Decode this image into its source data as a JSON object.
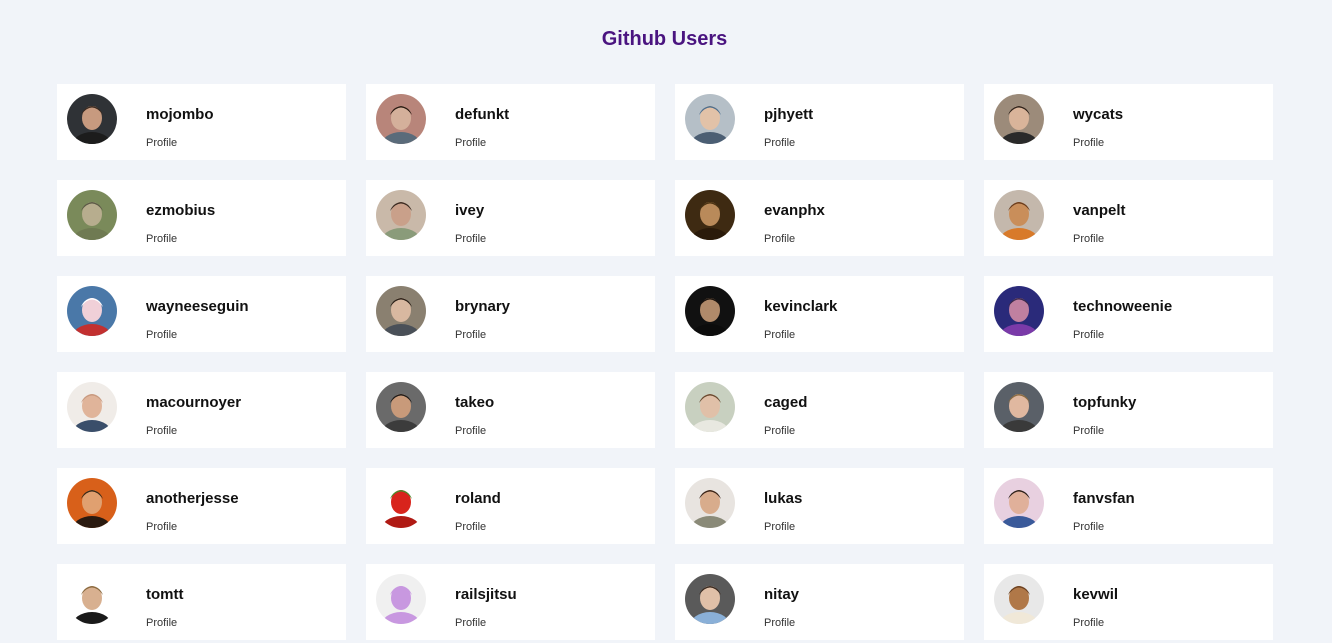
{
  "header": {
    "title": "Github Users"
  },
  "users": [
    {
      "login": "mojombo",
      "profile_label": "Profile",
      "avatar": {
        "bg": "#2f3236",
        "skin": "#c79a7f",
        "hair": "#3a2a20",
        "shirt": "#1c1c1c"
      }
    },
    {
      "login": "defunkt",
      "profile_label": "Profile",
      "avatar": {
        "bg": "#b8857a",
        "skin": "#d4b09b",
        "hair": "#2a1a12",
        "shirt": "#5a6b7a"
      }
    },
    {
      "login": "pjhyett",
      "profile_label": "Profile",
      "avatar": {
        "bg": "#b5bfc7",
        "skin": "#e2c2a8",
        "hair": "#4e6f8e",
        "shirt": "#4b5e73"
      }
    },
    {
      "login": "wycats",
      "profile_label": "Profile",
      "avatar": {
        "bg": "#9c8b7a",
        "skin": "#d9b49a",
        "hair": "#2e221a",
        "shirt": "#2a2a2a"
      }
    },
    {
      "login": "ezmobius",
      "profile_label": "Profile",
      "avatar": {
        "bg": "#7a8a5a",
        "skin": "#b7ad8e",
        "hair": "#5c5a46",
        "shirt": "#6f7a52"
      }
    },
    {
      "login": "ivey",
      "profile_label": "Profile",
      "avatar": {
        "bg": "#c9b9a9",
        "skin": "#c9a08a",
        "hair": "#3b2b22",
        "shirt": "#8a9b7a"
      }
    },
    {
      "login": "evanphx",
      "profile_label": "Profile",
      "avatar": {
        "bg": "#3e2a12",
        "skin": "#b98a5a",
        "hair": "#4a3212",
        "shirt": "#2a1a0a"
      }
    },
    {
      "login": "vanpelt",
      "profile_label": "Profile",
      "avatar": {
        "bg": "#c4b8ac",
        "skin": "#c98e5a",
        "hair": "#6a3c1c",
        "shirt": "#d87a2a"
      }
    },
    {
      "login": "wayneeseguin",
      "profile_label": "Profile",
      "avatar": {
        "bg": "#4a78a8",
        "skin": "#f0d0d8",
        "hair": "#ffffff",
        "shirt": "#c23030"
      }
    },
    {
      "login": "brynary",
      "profile_label": "Profile",
      "avatar": {
        "bg": "#8a8070",
        "skin": "#d8b8a0",
        "hair": "#2a2018",
        "shirt": "#4a5058"
      }
    },
    {
      "login": "kevinclark",
      "profile_label": "Profile",
      "avatar": {
        "bg": "#111111",
        "skin": "#b08a6a",
        "hair": "#1c140e",
        "shirt": "#0c0c0c"
      }
    },
    {
      "login": "technoweenie",
      "profile_label": "Profile",
      "avatar": {
        "bg": "#2a2a7a",
        "skin": "#c080a0",
        "hair": "#3c2a4a",
        "shirt": "#7a3aa8"
      }
    },
    {
      "login": "macournoyer",
      "profile_label": "Profile",
      "avatar": {
        "bg": "#f0ece8",
        "skin": "#e0b49a",
        "hair": "#c89a80",
        "shirt": "#3a4e6a"
      }
    },
    {
      "login": "takeo",
      "profile_label": "Profile",
      "avatar": {
        "bg": "#6a6a6a",
        "skin": "#c89a7a",
        "hair": "#1e1a18",
        "shirt": "#3c3c3c"
      }
    },
    {
      "login": "caged",
      "profile_label": "Profile",
      "avatar": {
        "bg": "#c8d0c0",
        "skin": "#e0c0a8",
        "hair": "#6a4a30",
        "shirt": "#e8e8e0"
      }
    },
    {
      "login": "topfunky",
      "profile_label": "Profile",
      "avatar": {
        "bg": "#5a6068",
        "skin": "#e0b8a0",
        "hair": "#8a6a40",
        "shirt": "#3a3a3a"
      }
    },
    {
      "login": "anotherjesse",
      "profile_label": "Profile",
      "avatar": {
        "bg": "#d8601a",
        "skin": "#e0a070",
        "hair": "#3a2a18",
        "shirt": "#2a1a10"
      }
    },
    {
      "login": "roland",
      "profile_label": "Profile",
      "avatar": {
        "bg": "#ffffff",
        "skin": "#d8241c",
        "hair": "#4a8a2a",
        "shirt": "#b01a14"
      }
    },
    {
      "login": "lukas",
      "profile_label": "Profile",
      "avatar": {
        "bg": "#e8e4e0",
        "skin": "#d8ac8c",
        "hair": "#3a2418",
        "shirt": "#8a8a78"
      }
    },
    {
      "login": "fanvsfan",
      "profile_label": "Profile",
      "avatar": {
        "bg": "#e8d0e0",
        "skin": "#e0b09a",
        "hair": "#2a1e18",
        "shirt": "#3a5a9a"
      }
    },
    {
      "login": "tomtt",
      "profile_label": "Profile",
      "avatar": {
        "bg": "#ffffff",
        "skin": "#d8b090",
        "hair": "#8a6a40",
        "shirt": "#1a1a1a"
      }
    },
    {
      "login": "railsjitsu",
      "profile_label": "Profile",
      "avatar": {
        "bg": "#f0f0f0",
        "skin": "#c898e0",
        "hair": "#c898e0",
        "shirt": "#c898e0"
      }
    },
    {
      "login": "nitay",
      "profile_label": "Profile",
      "avatar": {
        "bg": "#5a5a5a",
        "skin": "#e0c0a8",
        "hair": "#3a2a20",
        "shirt": "#8ab0d8"
      }
    },
    {
      "login": "kevwil",
      "profile_label": "Profile",
      "avatar": {
        "bg": "#e8e8e8",
        "skin": "#b07848",
        "hair": "#6a4020",
        "shirt": "#f0e8d8"
      }
    }
  ]
}
